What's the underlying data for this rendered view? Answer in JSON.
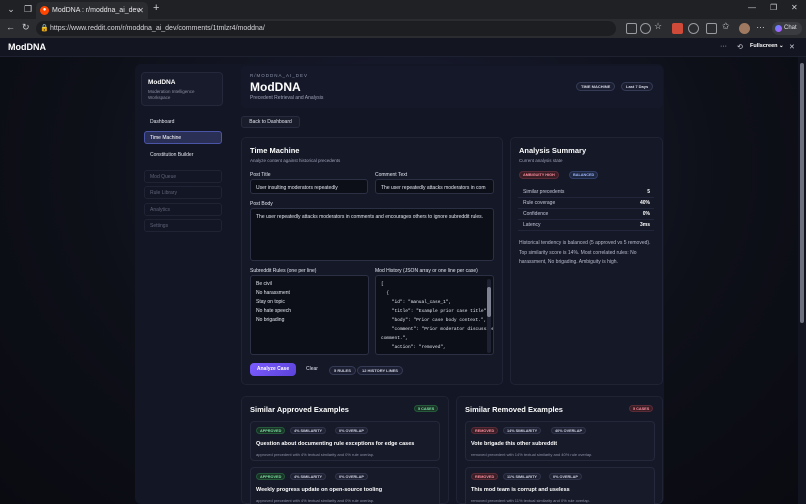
{
  "browser": {
    "tab_title": "ModDNA : r/moddna_ai_dev",
    "url": "https://www.reddit.com/r/moddna_ai_dev/comments/1tmlzr4/moddna/",
    "chat_label": "Chat"
  },
  "app": {
    "brand": "ModDNA",
    "fullscreen_label": "Fullscreen"
  },
  "sidebar": {
    "workspace_title": "ModDNA",
    "workspace_subtitle": "Moderation Intelligence Workspace",
    "items": [
      {
        "label": "Dashboard"
      },
      {
        "label": "Time Machine"
      },
      {
        "label": "Constitution Builder"
      },
      {
        "label": "Mod Queue"
      },
      {
        "label": "Rule Library"
      },
      {
        "label": "Analytics"
      },
      {
        "label": "Settings"
      }
    ]
  },
  "header": {
    "eyebrow": "R/MODDNA_AI_DEV",
    "title": "ModDNA",
    "subtitle": "Precedent Retrieval and Analysis",
    "chip_mode": "TIME MACHINE",
    "chip_range": "Last 7 Days",
    "back_label": "Back to Dashboard"
  },
  "time_machine": {
    "title": "Time Machine",
    "subtitle": "Analyze content against historical precedents",
    "post_title_label": "Post Title",
    "post_title_value": "User insulting moderators repeatedly",
    "comment_label": "Comment Text",
    "comment_value": "The user repeatedly attacks moderators in com",
    "post_body_label": "Post Body",
    "post_body_value": "The user repeatedly attacks moderators in comments and encourages others to ignore subreddit rules.",
    "rules_label": "Subreddit Rules (one per line)",
    "rules": [
      "Be civil",
      "No harassment",
      "Stay on topic",
      "No hate speech",
      "No brigading"
    ],
    "history_label": "Mod History (JSON array or one line per case)",
    "history_text": "[\n  {\n    \"id\": \"manual_case_1\",\n    \"title\": \"Example prior case title\",\n    \"body\": \"Prior case body context.\",\n    \"comment\": \"Prior moderator discussion\ncomment.\",\n    \"action\": \"removed\",",
    "analyze_label": "Analyze Case",
    "clear_label": "Clear",
    "rules_count": "5 RULES",
    "history_count": "12 HISTORY LINES"
  },
  "analysis": {
    "title": "Analysis Summary",
    "subtitle": "Current analysis state",
    "badge_ambiguity": "AMBIGUITY HIGH",
    "badge_balance": "BALANCED",
    "stats": [
      {
        "label": "Similar precedents",
        "value": "5"
      },
      {
        "label": "Rule coverage",
        "value": "40%"
      },
      {
        "label": "Confidence",
        "value": "0%"
      },
      {
        "label": "Latency",
        "value": "3ms"
      }
    ],
    "summary": "Historical tendency is balanced (5 approved vs 5 removed). Top similarity score is 14%. Most correlated rules: No harassment, No brigading. Ambiguity is high."
  },
  "approved": {
    "title": "Similar Approved Examples",
    "count": "5 CASES",
    "items": [
      {
        "status": "APPROVED",
        "similarity": "4% SIMILARITY",
        "overlap": "0% OVERLAP",
        "title": "Question about documenting rule exceptions for edge cases",
        "desc": "approved precedent with 4% textual similarity and 0% rule overlap."
      },
      {
        "status": "APPROVED",
        "similarity": "4% SIMILARITY",
        "overlap": "0% OVERLAP",
        "title": "Weekly progress update on open-source tooling",
        "desc": "approved precedent with 4% textual similarity and 0% rule overlap."
      }
    ]
  },
  "removed": {
    "title": "Similar Removed Examples",
    "count": "5 CASES",
    "items": [
      {
        "status": "REMOVED",
        "similarity": "14% SIMILARITY",
        "overlap": "40% OVERLAP",
        "title": "Vote brigade this other subreddit",
        "desc": "removed precedent with 14% textual similarity and 40% rule overlap."
      },
      {
        "status": "REMOVED",
        "similarity": "11% SIMILARITY",
        "overlap": "0% OVERLAP",
        "title": "This mod team is corrupt and useless",
        "desc": "removed precedent with 11% textual similarity and 0% rule overlap."
      }
    ]
  }
}
